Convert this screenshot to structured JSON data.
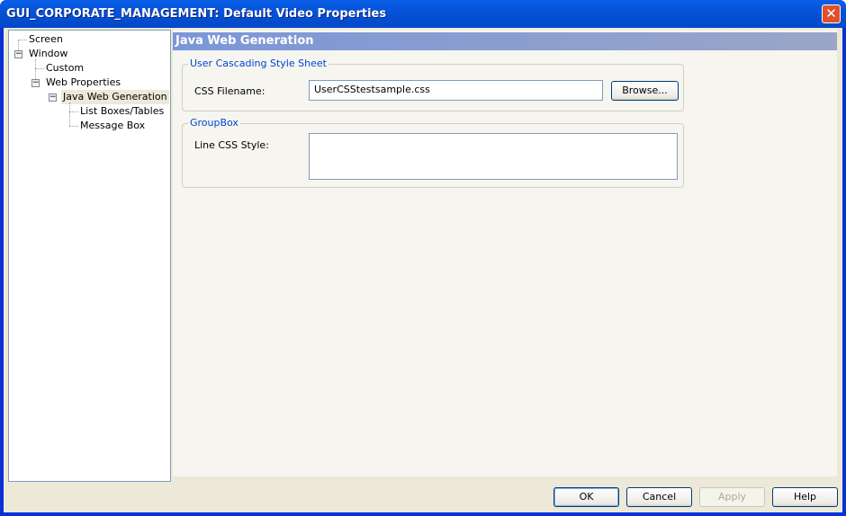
{
  "window": {
    "title": "GUI_CORPORATE_MANAGEMENT: Default Video Properties",
    "close_icon": "close-icon"
  },
  "tree": {
    "items": [
      {
        "label": "Screen"
      },
      {
        "label": "Window"
      },
      {
        "label": "Custom"
      },
      {
        "label": "Web Properties"
      },
      {
        "label": "Java Web Generation"
      },
      {
        "label": "List Boxes/Tables"
      },
      {
        "label": "Message Box"
      }
    ]
  },
  "panel": {
    "header": "Java Web Generation",
    "css_group": {
      "title": "User Cascading Style Sheet",
      "filename_label": "CSS Filename:",
      "filename_value": "UserCSStestsample.css",
      "browse_label": "Browse..."
    },
    "groupbox": {
      "title": "GroupBox",
      "line_css_label": "Line CSS Style:",
      "line_css_value": ""
    }
  },
  "buttons": {
    "ok": "OK",
    "cancel": "Cancel",
    "apply": "Apply",
    "help": "Help"
  }
}
